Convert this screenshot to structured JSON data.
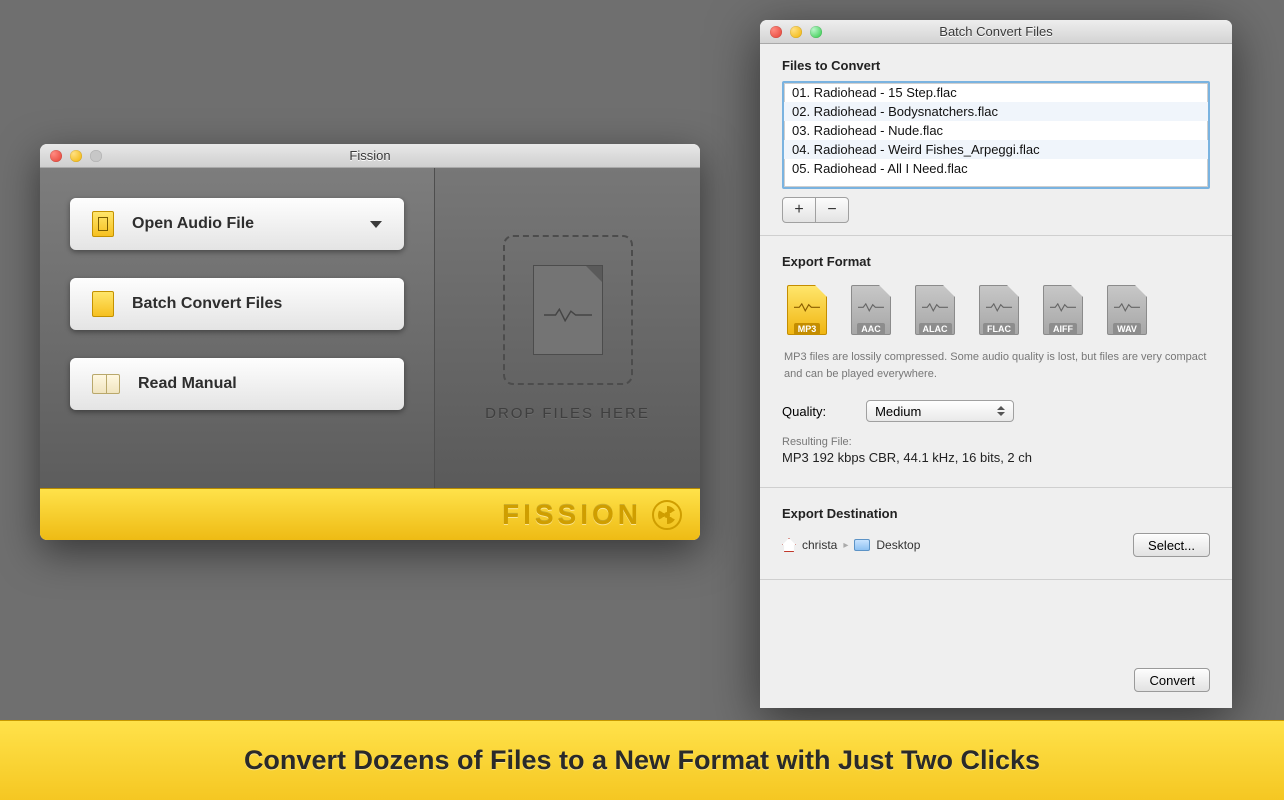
{
  "fission": {
    "title": "Fission",
    "open_audio": "Open Audio File",
    "batch_convert": "Batch Convert Files",
    "read_manual": "Read Manual",
    "drop_label": "DROP FILES HERE",
    "logo": "FISSION"
  },
  "batch": {
    "title": "Batch Convert Files",
    "files_heading": "Files to Convert",
    "files": [
      "01. Radiohead - 15 Step.flac",
      "02. Radiohead - Bodysnatchers.flac",
      "03. Radiohead - Nude.flac",
      "04. Radiohead - Weird Fishes_Arpeggi.flac",
      "05. Radiohead - All I Need.flac"
    ],
    "export_heading": "Export Format",
    "formats": [
      "MP3",
      "AAC",
      "ALAC",
      "FLAC",
      "AIFF",
      "WAV"
    ],
    "selected_format": "MP3",
    "format_description": "MP3 files are lossily compressed. Some audio quality is lost, but files are very compact and can be played everywhere.",
    "quality_label": "Quality:",
    "quality_value": "Medium",
    "resulting_label": "Resulting File:",
    "resulting_value": "MP3 192 kbps CBR, 44.1 kHz, 16 bits, 2 ch",
    "dest_heading": "Export Destination",
    "dest_user": "christa",
    "dest_folder": "Desktop",
    "select_btn": "Select...",
    "convert_btn": "Convert"
  },
  "banner": "Convert Dozens of Files to a New Format with Just Two Clicks"
}
